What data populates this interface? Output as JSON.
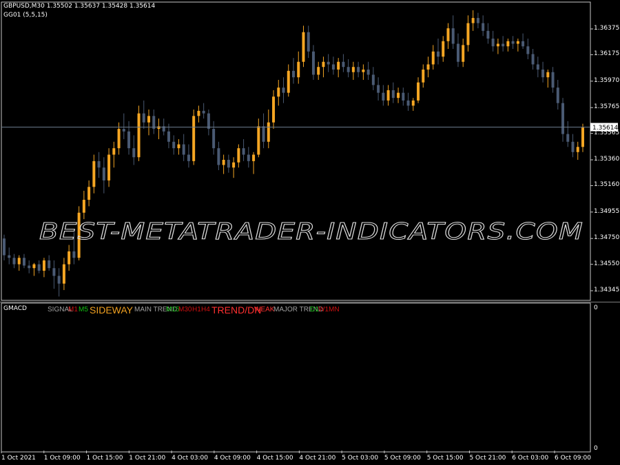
{
  "header": {
    "symbol_line": "GBPUSD,M30  1.35502 1.35637 1.35428 1.35614",
    "indicator_line": "GG01 (5,5,15)"
  },
  "price_axis": {
    "ticks": [
      "1.36375",
      "1.36175",
      "1.35970",
      "1.35765",
      "1.35565",
      "1.35360",
      "1.35160",
      "1.34955",
      "1.34750",
      "1.34550",
      "1.34345"
    ],
    "current_price": "1.35614"
  },
  "time_axis": {
    "ticks": [
      "1 Oct 2021",
      "1 Oct 09:00",
      "1 Oct 15:00",
      "1 Oct 21:00",
      "4 Oct 03:00",
      "4 Oct 09:00",
      "4 Oct 15:00",
      "4 Oct 21:00",
      "5 Oct 03:00",
      "5 Oct 09:00",
      "5 Oct 15:00",
      "5 Oct 21:00",
      "6 Oct 03:00",
      "6 Oct 09:00"
    ]
  },
  "watermark": {
    "text": "BEST-METATRADER-INDICATORS.COM"
  },
  "subwindow": {
    "name": "GMACD",
    "axis_top": "0",
    "axis_bottom": "0",
    "labels": [
      {
        "text": "SIGNAL",
        "color": "#a0a0a0",
        "size": 10
      },
      {
        "text": "M1",
        "color": "#d01010",
        "size": 10
      },
      {
        "text": "M5",
        "color": "#10c010",
        "size": 10
      },
      {
        "text": "SIDEWAY",
        "color": "#f0a020",
        "size": 14
      },
      {
        "text": "MAIN TREND",
        "color": "#a0a0a0",
        "size": 10
      },
      {
        "text": "M15",
        "color": "#10c010",
        "size": 10
      },
      {
        "text": "M30",
        "color": "#d01010",
        "size": 10
      },
      {
        "text": "H1",
        "color": "#d01010",
        "size": 10
      },
      {
        "text": "H4",
        "color": "#d01010",
        "size": 10
      },
      {
        "text": "TREND/DN",
        "color": "#ff3030",
        "size": 14
      },
      {
        "text": "WEAK",
        "color": "#ff3030",
        "size": 10
      },
      {
        "text": "MAJOR TREND",
        "color": "#a0a0a0",
        "size": 10
      },
      {
        "text": "D1",
        "color": "#10c010",
        "size": 10
      },
      {
        "text": "W1",
        "color": "#d01010",
        "size": 10
      },
      {
        "text": "MN",
        "color": "#d01010",
        "size": 10
      }
    ]
  },
  "colors": {
    "bull": "#f5a623",
    "bear": "#4a5a73",
    "frame": "#c8c8c8",
    "price_line": "#6b7b8c"
  },
  "chart_data": {
    "type": "candlestick",
    "symbol": "GBPUSD",
    "timeframe": "M30",
    "ylim": [
      1.3428,
      1.3652
    ],
    "candles": [
      [
        1.3475,
        1.3478,
        1.3458,
        1.3462
      ],
      [
        1.3462,
        1.3468,
        1.3455,
        1.346
      ],
      [
        1.346,
        1.3463,
        1.3452,
        1.3455
      ],
      [
        1.3455,
        1.3462,
        1.345,
        1.346
      ],
      [
        1.346,
        1.3463,
        1.3452,
        1.3454
      ],
      [
        1.3454,
        1.3458,
        1.3448,
        1.3452
      ],
      [
        1.3452,
        1.3456,
        1.3446,
        1.3455
      ],
      [
        1.3455,
        1.3458,
        1.3448,
        1.345
      ],
      [
        1.345,
        1.346,
        1.3445,
        1.3458
      ],
      [
        1.3458,
        1.3462,
        1.345,
        1.3452
      ],
      [
        1.3452,
        1.3458,
        1.3436,
        1.3446
      ],
      [
        1.3446,
        1.3452,
        1.343,
        1.344
      ],
      [
        1.344,
        1.346,
        1.3435,
        1.3455
      ],
      [
        1.3455,
        1.347,
        1.345,
        1.3465
      ],
      [
        1.3465,
        1.348,
        1.3455,
        1.346
      ],
      [
        1.346,
        1.35,
        1.3458,
        1.3495
      ],
      [
        1.3495,
        1.3512,
        1.349,
        1.3505
      ],
      [
        1.3505,
        1.352,
        1.35,
        1.3515
      ],
      [
        1.3515,
        1.354,
        1.351,
        1.3535
      ],
      [
        1.3535,
        1.3542,
        1.3522,
        1.353
      ],
      [
        1.353,
        1.3538,
        1.351,
        1.352
      ],
      [
        1.352,
        1.3545,
        1.3515,
        1.354
      ],
      [
        1.354,
        1.355,
        1.353,
        1.3545
      ],
      [
        1.3545,
        1.3565,
        1.354,
        1.356
      ],
      [
        1.356,
        1.3572,
        1.3552,
        1.3558
      ],
      [
        1.3558,
        1.3566,
        1.354,
        1.3545
      ],
      [
        1.3545,
        1.3555,
        1.3532,
        1.3538
      ],
      [
        1.3538,
        1.3578,
        1.3535,
        1.3572
      ],
      [
        1.3572,
        1.3582,
        1.356,
        1.3565
      ],
      [
        1.3565,
        1.3575,
        1.3555,
        1.357
      ],
      [
        1.357,
        1.3575,
        1.3556,
        1.356
      ],
      [
        1.356,
        1.3568,
        1.3552,
        1.3562
      ],
      [
        1.3562,
        1.3568,
        1.3555,
        1.3558
      ],
      [
        1.3558,
        1.3564,
        1.3545,
        1.355
      ],
      [
        1.355,
        1.3555,
        1.354,
        1.3545
      ],
      [
        1.3545,
        1.3552,
        1.354,
        1.3548
      ],
      [
        1.3548,
        1.3556,
        1.3535,
        1.354
      ],
      [
        1.354,
        1.3548,
        1.353,
        1.3535
      ],
      [
        1.3535,
        1.3575,
        1.3532,
        1.357
      ],
      [
        1.357,
        1.3578,
        1.3565,
        1.3574
      ],
      [
        1.3574,
        1.358,
        1.3568,
        1.3572
      ],
      [
        1.3572,
        1.3575,
        1.3555,
        1.356
      ],
      [
        1.356,
        1.3566,
        1.354,
        1.3545
      ],
      [
        1.3545,
        1.355,
        1.3528,
        1.3532
      ],
      [
        1.3532,
        1.354,
        1.3525,
        1.3536
      ],
      [
        1.3536,
        1.354,
        1.3526,
        1.353
      ],
      [
        1.353,
        1.3538,
        1.3522,
        1.3534
      ],
      [
        1.3534,
        1.3548,
        1.353,
        1.3545
      ],
      [
        1.3545,
        1.3552,
        1.3535,
        1.354
      ],
      [
        1.354,
        1.3546,
        1.353,
        1.3535
      ],
      [
        1.3535,
        1.3542,
        1.3525,
        1.354
      ],
      [
        1.354,
        1.3568,
        1.3538,
        1.3562
      ],
      [
        1.3562,
        1.3572,
        1.3545,
        1.355
      ],
      [
        1.355,
        1.3575,
        1.3545,
        1.3565
      ],
      [
        1.3565,
        1.359,
        1.356,
        1.3585
      ],
      [
        1.3585,
        1.3598,
        1.3578,
        1.3592
      ],
      [
        1.3592,
        1.36,
        1.358,
        1.3588
      ],
      [
        1.3588,
        1.361,
        1.3585,
        1.3605
      ],
      [
        1.3605,
        1.3615,
        1.3595,
        1.36
      ],
      [
        1.36,
        1.362,
        1.3595,
        1.3612
      ],
      [
        1.3612,
        1.364,
        1.3608,
        1.3635
      ],
      [
        1.3635,
        1.364,
        1.3615,
        1.362
      ],
      [
        1.362,
        1.3625,
        1.3598,
        1.3602
      ],
      [
        1.3602,
        1.3612,
        1.3598,
        1.3608
      ],
      [
        1.3608,
        1.3616,
        1.36,
        1.3612
      ],
      [
        1.3612,
        1.3618,
        1.3604,
        1.361
      ],
      [
        1.361,
        1.3616,
        1.3602,
        1.3606
      ],
      [
        1.3606,
        1.3615,
        1.36,
        1.3612
      ],
      [
        1.3612,
        1.3618,
        1.3604,
        1.3608
      ],
      [
        1.3608,
        1.3614,
        1.36,
        1.3604
      ],
      [
        1.3604,
        1.3612,
        1.3598,
        1.3608
      ],
      [
        1.3608,
        1.3612,
        1.36,
        1.3604
      ],
      [
        1.3604,
        1.361,
        1.3598,
        1.3606
      ],
      [
        1.3606,
        1.3612,
        1.3598,
        1.3602
      ],
      [
        1.3602,
        1.3608,
        1.359,
        1.3594
      ],
      [
        1.3594,
        1.36,
        1.3582,
        1.3588
      ],
      [
        1.3588,
        1.3594,
        1.3578,
        1.3582
      ],
      [
        1.3582,
        1.3594,
        1.3578,
        1.359
      ],
      [
        1.359,
        1.3596,
        1.358,
        1.3584
      ],
      [
        1.3584,
        1.3592,
        1.358,
        1.3588
      ],
      [
        1.3588,
        1.3592,
        1.3578,
        1.3582
      ],
      [
        1.3582,
        1.3588,
        1.3574,
        1.3578
      ],
      [
        1.3578,
        1.3584,
        1.3574,
        1.3582
      ],
      [
        1.3582,
        1.36,
        1.358,
        1.3596
      ],
      [
        1.3596,
        1.361,
        1.3592,
        1.3606
      ],
      [
        1.3606,
        1.3616,
        1.36,
        1.361
      ],
      [
        1.361,
        1.3625,
        1.3606,
        1.362
      ],
      [
        1.362,
        1.363,
        1.361,
        1.3616
      ],
      [
        1.3616,
        1.3632,
        1.3612,
        1.3628
      ],
      [
        1.3628,
        1.3642,
        1.3622,
        1.3638
      ],
      [
        1.3638,
        1.3648,
        1.3622,
        1.3626
      ],
      [
        1.3626,
        1.3634,
        1.3608,
        1.3612
      ],
      [
        1.3612,
        1.363,
        1.3608,
        1.3625
      ],
      [
        1.3625,
        1.3648,
        1.362,
        1.3642
      ],
      [
        1.3642,
        1.3652,
        1.3636,
        1.3646
      ],
      [
        1.3646,
        1.365,
        1.3638,
        1.3642
      ],
      [
        1.3642,
        1.3648,
        1.3632,
        1.3636
      ],
      [
        1.3636,
        1.3642,
        1.3626,
        1.363
      ],
      [
        1.363,
        1.3636,
        1.362,
        1.3624
      ],
      [
        1.3624,
        1.363,
        1.3618,
        1.3626
      ],
      [
        1.3626,
        1.3632,
        1.362,
        1.3624
      ],
      [
        1.3624,
        1.363,
        1.362,
        1.3628
      ],
      [
        1.3628,
        1.3632,
        1.3622,
        1.3626
      ],
      [
        1.3626,
        1.363,
        1.362,
        1.3628
      ],
      [
        1.3628,
        1.3634,
        1.3622,
        1.3624
      ],
      [
        1.3624,
        1.363,
        1.3614,
        1.3618
      ],
      [
        1.3618,
        1.3622,
        1.3606,
        1.361
      ],
      [
        1.361,
        1.3616,
        1.36,
        1.3606
      ],
      [
        1.3606,
        1.3612,
        1.3596,
        1.36
      ],
      [
        1.36,
        1.3606,
        1.3592,
        1.3604
      ],
      [
        1.3604,
        1.3608,
        1.3588,
        1.3592
      ],
      [
        1.3592,
        1.3598,
        1.3575,
        1.358
      ],
      [
        1.358,
        1.3584,
        1.355,
        1.3556
      ],
      [
        1.3556,
        1.3566,
        1.3546,
        1.355
      ],
      [
        1.355,
        1.3556,
        1.3538,
        1.3542
      ],
      [
        1.3542,
        1.355,
        1.3536,
        1.3546
      ],
      [
        1.3546,
        1.3564,
        1.3542,
        1.3561
      ]
    ]
  }
}
